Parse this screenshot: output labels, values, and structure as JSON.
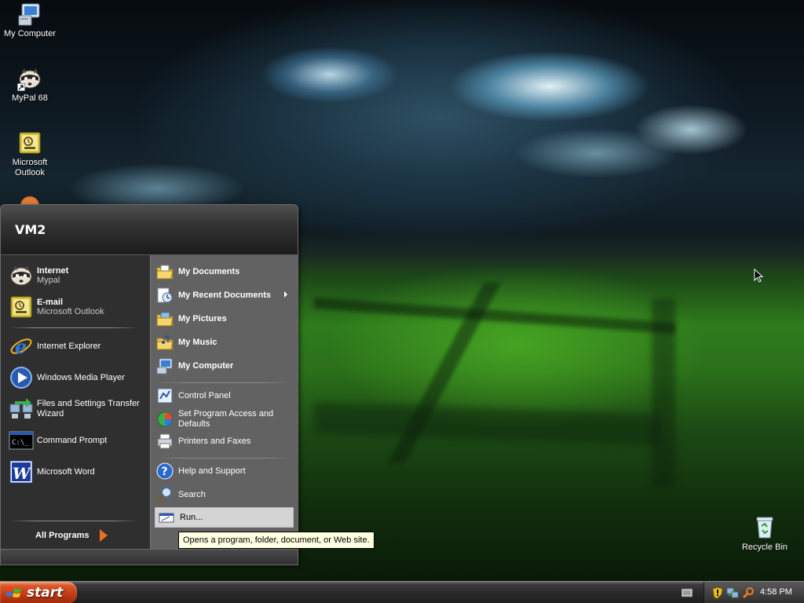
{
  "desktop": {
    "icons": [
      {
        "label": "My Computer"
      },
      {
        "label": "MyPal 68"
      },
      {
        "label": "Microsoft Outlook"
      },
      {
        "label": "Recycle Bin"
      }
    ]
  },
  "start_menu": {
    "user_name": "VM2",
    "pinned": [
      {
        "title": "Internet",
        "subtitle": "Mypal"
      },
      {
        "title": "E-mail",
        "subtitle": "Microsoft Outlook"
      }
    ],
    "recent": [
      {
        "label": "Internet Explorer"
      },
      {
        "label": "Windows Media Player"
      },
      {
        "label": "Files and Settings Transfer Wizard"
      },
      {
        "label": "Command Prompt"
      },
      {
        "label": "Microsoft Word"
      }
    ],
    "all_programs_label": "All Programs",
    "places": [
      {
        "label": "My Documents"
      },
      {
        "label": "My Recent Documents"
      },
      {
        "label": "My Pictures"
      },
      {
        "label": "My Music"
      },
      {
        "label": "My Computer"
      }
    ],
    "settings": [
      {
        "label": "Control Panel"
      },
      {
        "label": "Set Program Access and Defaults"
      },
      {
        "label": "Printers and Faxes"
      }
    ],
    "help": [
      {
        "label": "Help and Support"
      },
      {
        "label": "Search"
      },
      {
        "label": "Run..."
      }
    ]
  },
  "tooltip": {
    "text": "Opens a program, folder, document, or Web site."
  },
  "taskbar": {
    "start_label": "start",
    "clock": "4:58 PM"
  },
  "colors": {
    "tooltip_bg": "#ffffe1",
    "start_button": "#c3401a",
    "menu_dark": "#2f2f2f",
    "menu_light": "#626262"
  }
}
